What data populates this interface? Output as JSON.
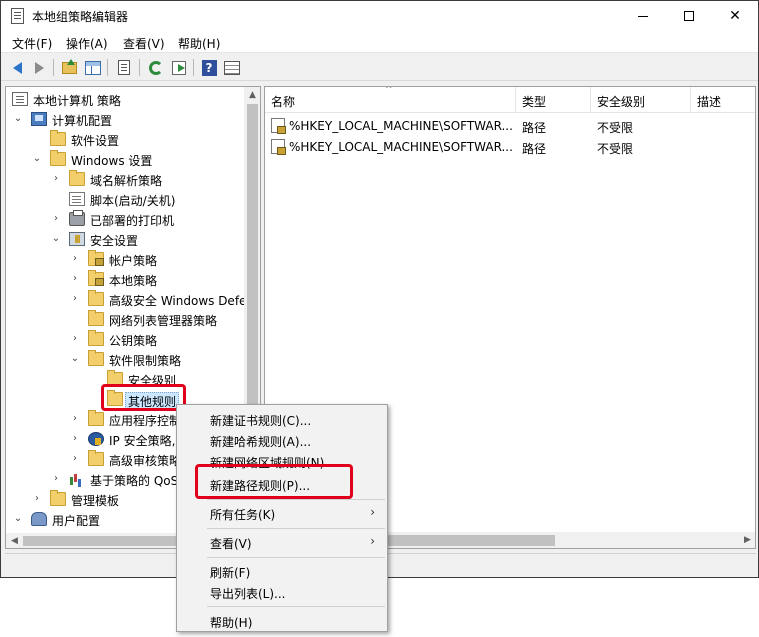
{
  "window": {
    "title": "本地组策略编辑器"
  },
  "menubar": {
    "file": "文件(F)",
    "action": "操作(A)",
    "view": "查看(V)",
    "help": "帮助(H)"
  },
  "tree": {
    "root": "本地计算机 策略",
    "computer_config": "计算机配置",
    "software_settings": "软件设置",
    "windows_settings": "Windows 设置",
    "dns_policy": "域名解析策略",
    "scripts": "脚本(启动/关机)",
    "printers": "已部署的打印机",
    "security_settings": "安全设置",
    "account_policies": "帐户策略",
    "local_policies": "本地策略",
    "wf_advanced": "高级安全 Windows Defe",
    "network_list": "网络列表管理器策略",
    "public_key": "公钥策略",
    "srp": "软件限制策略",
    "security_levels": "安全级别",
    "additional_rules": "其他规则",
    "app_control": "应用程序控制",
    "ipsec": "IP 安全策略,",
    "audit": "高级审核策略",
    "qos": "基于策略的 QoS",
    "admin_templates": "管理模板",
    "user_config": "用户配置"
  },
  "list": {
    "columns": [
      "名称",
      "类型",
      "安全级别",
      "描述"
    ],
    "rows": [
      {
        "name": "%HKEY_LOCAL_MACHINE\\SOFTWAR...",
        "type": "路径",
        "level": "不受限"
      },
      {
        "name": "%HKEY_LOCAL_MACHINE\\SOFTWAR...",
        "type": "路径",
        "level": "不受限"
      }
    ]
  },
  "context_menu": {
    "new_cert_rule": "新建证书规则(C)...",
    "new_hash_rule": "新建哈希规则(A)...",
    "new_zone_rule": "新建网络区域规则(N)...",
    "new_path_rule": "新建路径规则(P)...",
    "all_tasks": "所有任务(K)",
    "view": "查看(V)",
    "refresh": "刷新(F)",
    "export_list": "导出列表(L)...",
    "help": "帮助(H)"
  },
  "colors": {
    "highlight_box": "#e0001a",
    "selection": "#cce8ff"
  }
}
